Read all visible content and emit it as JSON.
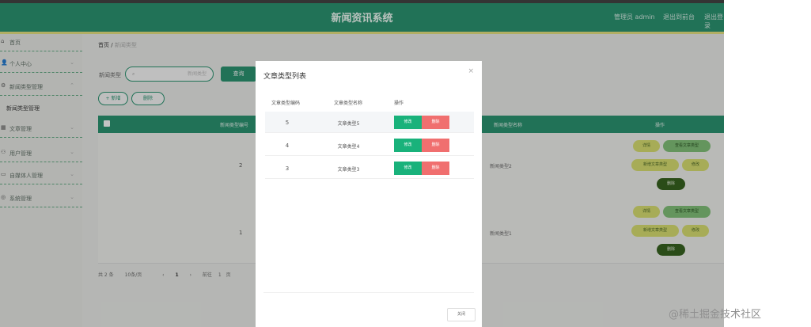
{
  "app": {
    "title": "新闻资讯系统",
    "admin_label": "管理员 admin",
    "exit_system": "退出到前台",
    "logout": "退出登录"
  },
  "sidebar": {
    "items": [
      {
        "label": "首页",
        "icon": "home-icon"
      },
      {
        "label": "个人中心",
        "icon": "user-icon"
      },
      {
        "label": "新闻类型管理",
        "icon": "gear-icon"
      },
      {
        "label": "文章管理",
        "icon": "grid-icon"
      },
      {
        "label": "用户管理",
        "icon": "users-icon"
      },
      {
        "label": "自媒体人管理",
        "icon": "folder-icon"
      },
      {
        "label": "系统管理",
        "icon": "settings-icon"
      }
    ],
    "sub_item": "新闻类型管理"
  },
  "breadcrumb": {
    "home": "首页",
    "separator": "/",
    "current": "新闻类型"
  },
  "filter": {
    "label": "新闻类型",
    "placeholder": "新闻类型",
    "search_button": "查询"
  },
  "toolbar": {
    "add_label": "+ 新增",
    "delete_label": "删除"
  },
  "table": {
    "headers": [
      "新闻类型编号",
      "新闻类型名称",
      "操作"
    ],
    "rows": [
      {
        "id": "2",
        "name": "新闻类型2",
        "actions": [
          "详情",
          "查看文章类型",
          "新增文章类型",
          "修改",
          "删除"
        ]
      },
      {
        "id": "1",
        "name": "新闻类型1",
        "actions": [
          "详情",
          "查看文章类型",
          "新增文章类型",
          "修改",
          "删除"
        ]
      }
    ]
  },
  "pager": {
    "total": "共 2 条",
    "size": "10条/页",
    "prev": "‹",
    "page": "1",
    "next": "›",
    "goto": "前往",
    "goto_page": "1",
    "page_unit": "页"
  },
  "dialog": {
    "title": "文章类型列表",
    "close_icon": "×",
    "headers": [
      "文章类型编码",
      "文章类型名称",
      "操作"
    ],
    "rows": [
      {
        "id": "5",
        "name": "文章类型5",
        "edit": "修改",
        "delete": "删除"
      },
      {
        "id": "4",
        "name": "文章类型4",
        "edit": "修改",
        "delete": "删除"
      },
      {
        "id": "3",
        "name": "文章类型3",
        "edit": "修改",
        "delete": "删除"
      }
    ],
    "close_button": "关闭"
  },
  "watermark": "@稀土掘金技术社区",
  "colors": {
    "primary": "#1f8f6a",
    "accent_yellow": "#e6e27a",
    "edit_green": "#19b27b",
    "delete_red": "#f06f6f"
  }
}
